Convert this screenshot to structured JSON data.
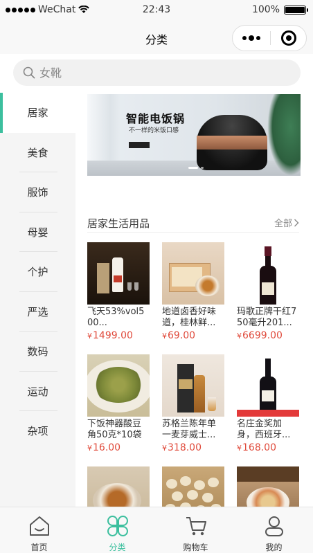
{
  "status_bar": {
    "carrier": "WeChat",
    "time": "22:43",
    "battery": "100%"
  },
  "nav": {
    "title": "分类"
  },
  "search": {
    "placeholder": "女靴"
  },
  "sidebar": {
    "items": [
      {
        "label": "居家"
      },
      {
        "label": "美食"
      },
      {
        "label": "服饰"
      },
      {
        "label": "母婴"
      },
      {
        "label": "个护"
      },
      {
        "label": "严选"
      },
      {
        "label": "数码"
      },
      {
        "label": "运动"
      },
      {
        "label": "杂项"
      }
    ],
    "active_index": 0
  },
  "banner": {
    "title": "智能电饭锅",
    "subtitle": "不一样的米饭口感"
  },
  "section": {
    "title": "居家生活用品",
    "more_label": "全部"
  },
  "currency": "¥",
  "products": [
    {
      "name": "飞天53%vol500...",
      "price": "1499.00",
      "thumb": "moutai"
    },
    {
      "name": "地道卤香好味道，桂林鲜...",
      "price": "69.00",
      "thumb": "duck"
    },
    {
      "name": "玛歌正牌干红750毫升201...",
      "price": "6699.00",
      "thumb": "wine"
    },
    {
      "name": "下饭神器酸豆角50克*10袋",
      "price": "16.00",
      "thumb": "beans"
    },
    {
      "name": "苏格兰陈年单一麦芽威士...",
      "price": "318.00",
      "thumb": "whisky"
    },
    {
      "name": "名庄金奖加身，西班牙...",
      "price": "168.00",
      "thumb": "wine2"
    },
    {
      "name": "",
      "price": "",
      "thumb": "curry"
    },
    {
      "name": "",
      "price": "",
      "thumb": "nuts"
    },
    {
      "name": "",
      "price": "",
      "thumb": "noodle"
    }
  ],
  "tabbar": {
    "items": [
      {
        "label": "首页",
        "icon": "home-icon"
      },
      {
        "label": "分类",
        "icon": "category-icon"
      },
      {
        "label": "购物车",
        "icon": "cart-icon"
      },
      {
        "label": "我的",
        "icon": "profile-icon"
      }
    ],
    "active_index": 1
  },
  "colors": {
    "accent": "#3cbf9e",
    "price": "#e04b3c"
  }
}
